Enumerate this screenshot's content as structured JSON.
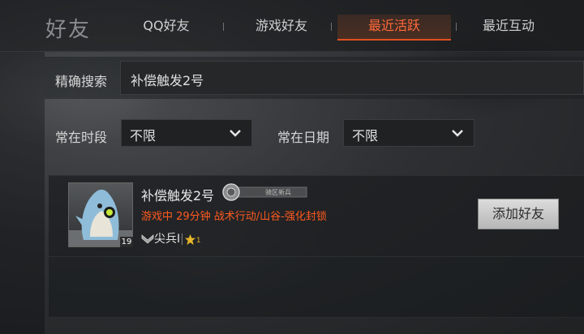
{
  "header": {
    "title": "好友",
    "tabs": [
      {
        "label": "QQ好友",
        "active": false
      },
      {
        "label": "游戏好友",
        "active": false
      },
      {
        "label": "最近活跃",
        "active": true
      },
      {
        "label": "最近互动",
        "active": false
      }
    ]
  },
  "filters": {
    "search_label": "精确搜索",
    "search_value": "补偿触发2号",
    "time_label": "常在时段",
    "time_value": "不限",
    "date_label": "常在日期",
    "date_value": "不限"
  },
  "friend": {
    "name": "补偿触发2号",
    "badge_text": "骑区新兵",
    "status": "游戏中 29分钟 战术行动/山谷-强化封锁",
    "level": "19",
    "rank": "尖兵I",
    "rank_star_count": "1",
    "add_button": "添加好友"
  },
  "colors": {
    "accent": "#ff5a1f",
    "active_tab_border": "#e0501e"
  }
}
